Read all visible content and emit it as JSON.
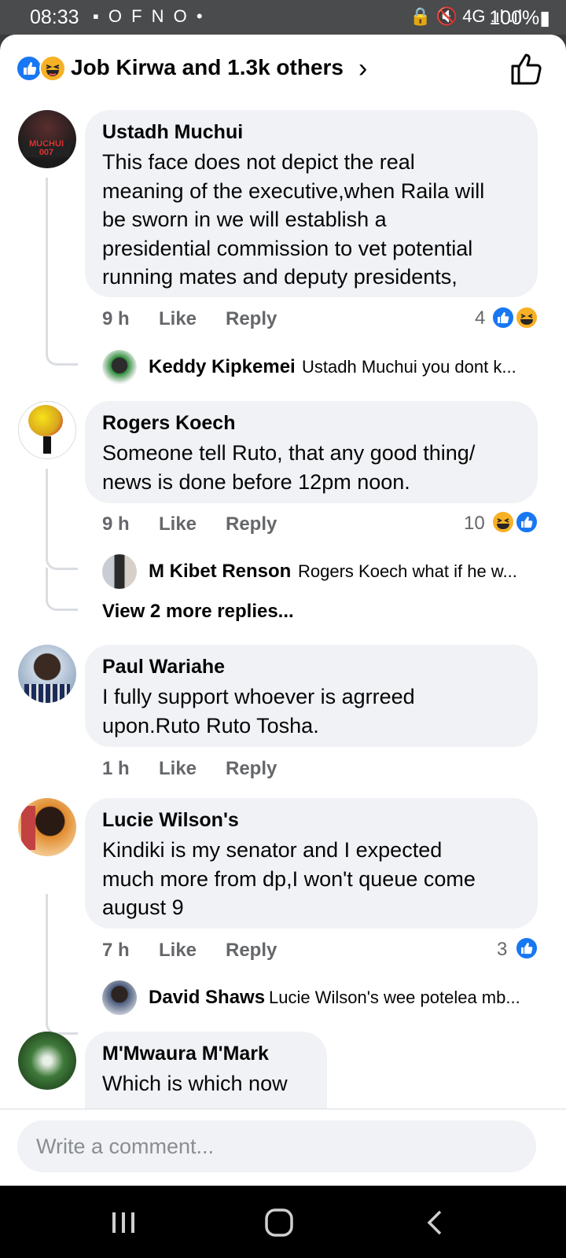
{
  "status_bar": {
    "time": "08:33",
    "notification_icons": "▪ O F N O •",
    "system_icons": "🔒 🔇 4G .ıl .ıl",
    "battery_text": "100%"
  },
  "header": {
    "reactions_text": "Job Kirwa and 1.3k others",
    "reaction_icons": [
      "like-icon",
      "haha-icon"
    ]
  },
  "comments": [
    {
      "author": "Ustadh Muchui",
      "text": "This face does not depict the real\nmeaning of the executive,when Raila will\nbe sworn in we will establish a\npresidential commission to vet potential\nrunning mates and deputy presidents,",
      "time": "9 h",
      "like_label": "Like",
      "reply_label": "Reply",
      "reaction_count": "4",
      "reply": {
        "author": "Keddy Kipkemei",
        "text": "Ustadh Muchui you dont k..."
      }
    },
    {
      "author": "Rogers Koech",
      "text": "Someone tell Ruto, that any good thing/\nnews is done before 12pm noon.",
      "time": "9 h",
      "like_label": "Like",
      "reply_label": "Reply",
      "reaction_count": "10",
      "reply": {
        "author": "M Kibet Renson",
        "text": "Rogers Koech what if he w..."
      },
      "more_replies": "View 2 more replies..."
    },
    {
      "author": "Paul Wariahe",
      "text": "I fully support whoever is agrreed\nupon.Ruto Ruto Tosha.",
      "time": "1 h",
      "like_label": "Like",
      "reply_label": "Reply"
    },
    {
      "author": "Lucie Wilson's",
      "text": "Kindiki is my senator and I expected\nmuch more from dp,I won't queue come\naugust 9",
      "time": "7 h",
      "like_label": "Like",
      "reply_label": "Reply",
      "reaction_count": "3",
      "reply": {
        "author": "David Shaws",
        "text": "Lucie Wilson's wee potelea mb..."
      }
    },
    {
      "author": "M'Mwaura M'Mark",
      "text": "Which is which now"
    }
  ],
  "composer": {
    "placeholder": "Write a comment..."
  },
  "colors": {
    "accent_blue": "#1877f2",
    "haha_yellow": "#f7b125",
    "bubble": "#f0f2f5",
    "meta_gray": "#65676b"
  }
}
